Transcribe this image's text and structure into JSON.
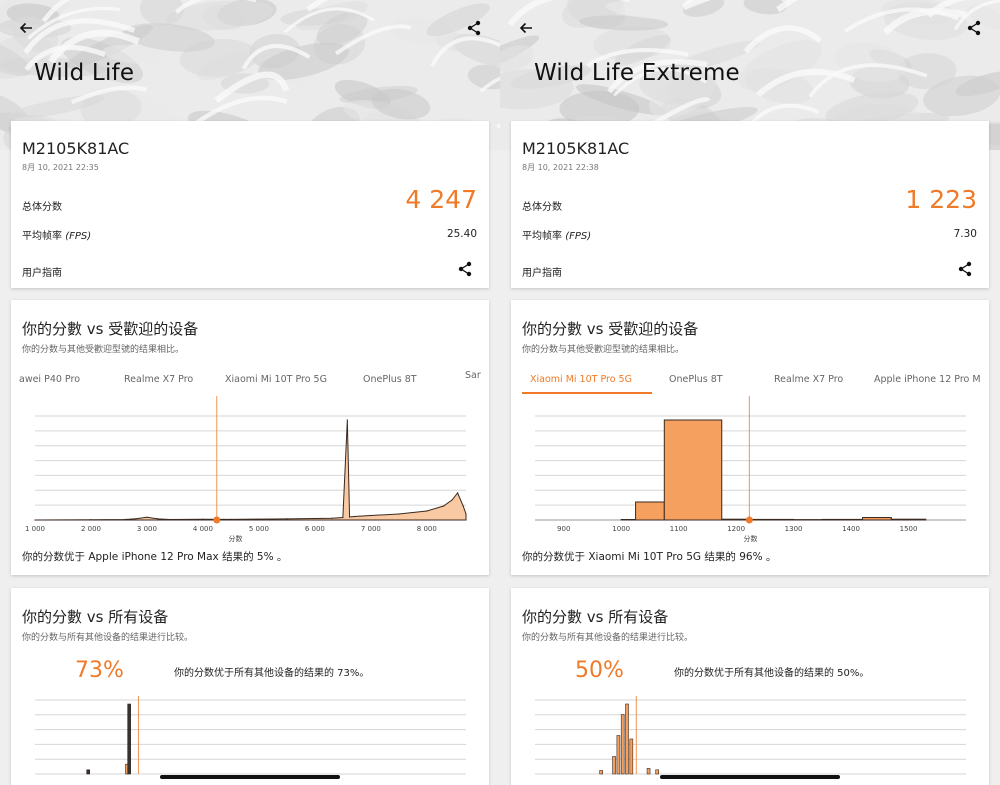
{
  "colors": {
    "accent": "#f07a27",
    "fill": "#f6a05f",
    "grid": "#d6d6d6"
  },
  "panes": [
    {
      "benchmark_title": "Wild Life",
      "summary": {
        "device": "M2105K81AC",
        "datetime": "8月 10, 2021 22:35",
        "overall_label": "总体分数",
        "overall_score": "4 247",
        "fps_label": "平均帧率",
        "fps_unit": "(FPS)",
        "fps_value": "25.40",
        "guide_label": "用户指南"
      },
      "popular": {
        "title": "你的分數 vs 受歡迎的设备",
        "subtitle": "你的分数与其他受歡迎型號的结果相比。",
        "tabs": [
          "awei P40 Pro",
          "Realme X7 Pro",
          "Xiaomi Mi 10T Pro 5G",
          "OnePlus 8T",
          "Sar"
        ],
        "active_tab": -1,
        "beat_text": "你的分数优于 Apple iPhone 12 Pro Max 结果的 5% 。"
      },
      "all": {
        "title": "你的分數 vs 所有设备",
        "subtitle": "你的分数与所有其他设备的结果进行比较。",
        "percent": "73%",
        "percent_text": "你的分数优于所有其他设备的结果的 73%。"
      },
      "chart_data": {
        "type": "area",
        "xlabel": "分数",
        "x_ticks": [
          "1 000",
          "2 000",
          "3 000",
          "4 000",
          "5 000",
          "6 000",
          "7 000",
          "8 000"
        ],
        "xlim": [
          1000,
          8700
        ],
        "marker": 4247,
        "x": [
          1000,
          2000,
          2600,
          2800,
          3000,
          3200,
          3400,
          4000,
          4500,
          5000,
          5500,
          6000,
          6300,
          6500,
          6580,
          6620,
          6700,
          7000,
          7500,
          8000,
          8300,
          8450,
          8550,
          8650,
          8700
        ],
        "values": [
          0,
          0.3,
          0.5,
          1.2,
          2.8,
          1.1,
          0.5,
          0.8,
          0.6,
          0.9,
          1.1,
          1.5,
          1.8,
          2.5,
          100,
          3,
          3.5,
          4.5,
          6,
          9,
          14,
          20,
          27,
          14,
          6
        ]
      },
      "all_chart": {
        "bars": [
          {
            "x": 0.12,
            "v": 0.06,
            "c": "#333"
          },
          {
            "x": 0.21,
            "v": 0.14,
            "c": "#f6a05f"
          },
          {
            "x": 0.215,
            "v": 1.0,
            "c": "#333"
          }
        ],
        "marker": 0.24
      }
    },
    {
      "benchmark_title": "Wild Life Extreme",
      "summary": {
        "device": "M2105K81AC",
        "datetime": "8月 10, 2021 22:38",
        "overall_label": "总体分数",
        "overall_score": "1 223",
        "fps_label": "平均帧率",
        "fps_unit": "(FPS)",
        "fps_value": "7.30",
        "guide_label": "用户指南"
      },
      "popular": {
        "title": "你的分數 vs 受歡迎的设备",
        "subtitle": "你的分数与其他受歡迎型號的结果相比。",
        "tabs": [
          "Xiaomi Mi 10T Pro 5G",
          "OnePlus 8T",
          "Realme X7 Pro",
          "Apple iPhone 12 Pro M"
        ],
        "active_tab": 0,
        "beat_text": "你的分数优于 Xiaomi Mi 10T Pro 5G 结果的 96% 。"
      },
      "all": {
        "title": "你的分數 vs 所有设备",
        "subtitle": "你的分数与所有其他设备的结果进行比较。",
        "percent": "50%",
        "percent_text": "你的分数优于所有其他设备的结果的 50%。"
      },
      "chart_data": {
        "type": "bar",
        "xlabel": "分数",
        "x_ticks": [
          "900",
          "1000",
          "1100",
          "1200",
          "1300",
          "1400",
          "1500"
        ],
        "xlim": [
          850,
          1600
        ],
        "marker": 1223,
        "bins": [
          {
            "from": 1000,
            "to": 1025,
            "value": 0.5
          },
          {
            "from": 1025,
            "to": 1075,
            "value": 18
          },
          {
            "from": 1075,
            "to": 1175,
            "value": 100
          },
          {
            "from": 1175,
            "to": 1225,
            "value": 0.8
          },
          {
            "from": 1225,
            "to": 1300,
            "value": 0.6
          },
          {
            "from": 1300,
            "to": 1350,
            "value": 0.4
          },
          {
            "from": 1350,
            "to": 1420,
            "value": 0.6
          },
          {
            "from": 1420,
            "to": 1470,
            "value": 2.5
          },
          {
            "from": 1470,
            "to": 1530,
            "value": 0.8
          }
        ]
      },
      "all_chart": {
        "bars": [
          {
            "x": 0.15,
            "v": 0.05,
            "c": "#f6a05f"
          },
          {
            "x": 0.18,
            "v": 0.25,
            "c": "#f6a05f"
          },
          {
            "x": 0.19,
            "v": 0.55,
            "c": "#f6a05f"
          },
          {
            "x": 0.2,
            "v": 0.85,
            "c": "#f6a05f"
          },
          {
            "x": 0.21,
            "v": 1.0,
            "c": "#f6a05f"
          },
          {
            "x": 0.22,
            "v": 0.5,
            "c": "#f6a05f"
          },
          {
            "x": 0.26,
            "v": 0.08,
            "c": "#f6a05f"
          },
          {
            "x": 0.28,
            "v": 0.06,
            "c": "#f6a05f"
          }
        ],
        "marker": 0.235
      }
    }
  ]
}
